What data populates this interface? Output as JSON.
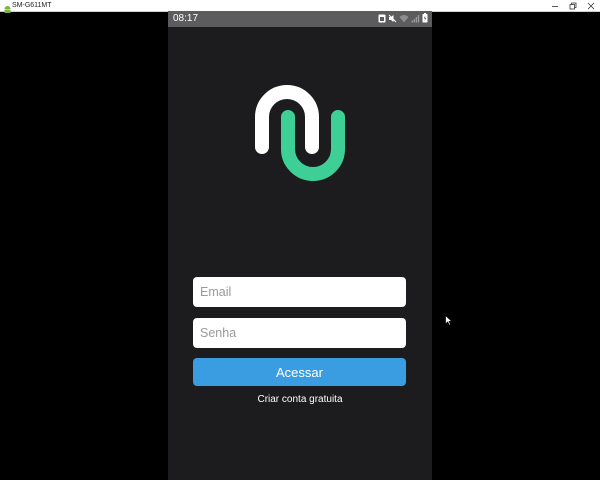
{
  "window": {
    "title": "SM-G611MT",
    "controls": [
      "minimize-icon",
      "restore-icon",
      "close-icon"
    ]
  },
  "statusbar": {
    "time": "08:17",
    "icons": [
      "sim-icon",
      "mute-icon",
      "wifi-icon",
      "signal-icon",
      "battery-icon"
    ]
  },
  "login": {
    "email_placeholder": "Email",
    "password_placeholder": "Senha",
    "submit_label": "Acessar",
    "signup_label": "Criar conta gratuita"
  },
  "colors": {
    "background": "#1c1b1d",
    "logo_white": "#ffffff",
    "logo_green": "#3ecf96",
    "button": "#3a9de1",
    "statusbar": "#5c5c5e"
  }
}
